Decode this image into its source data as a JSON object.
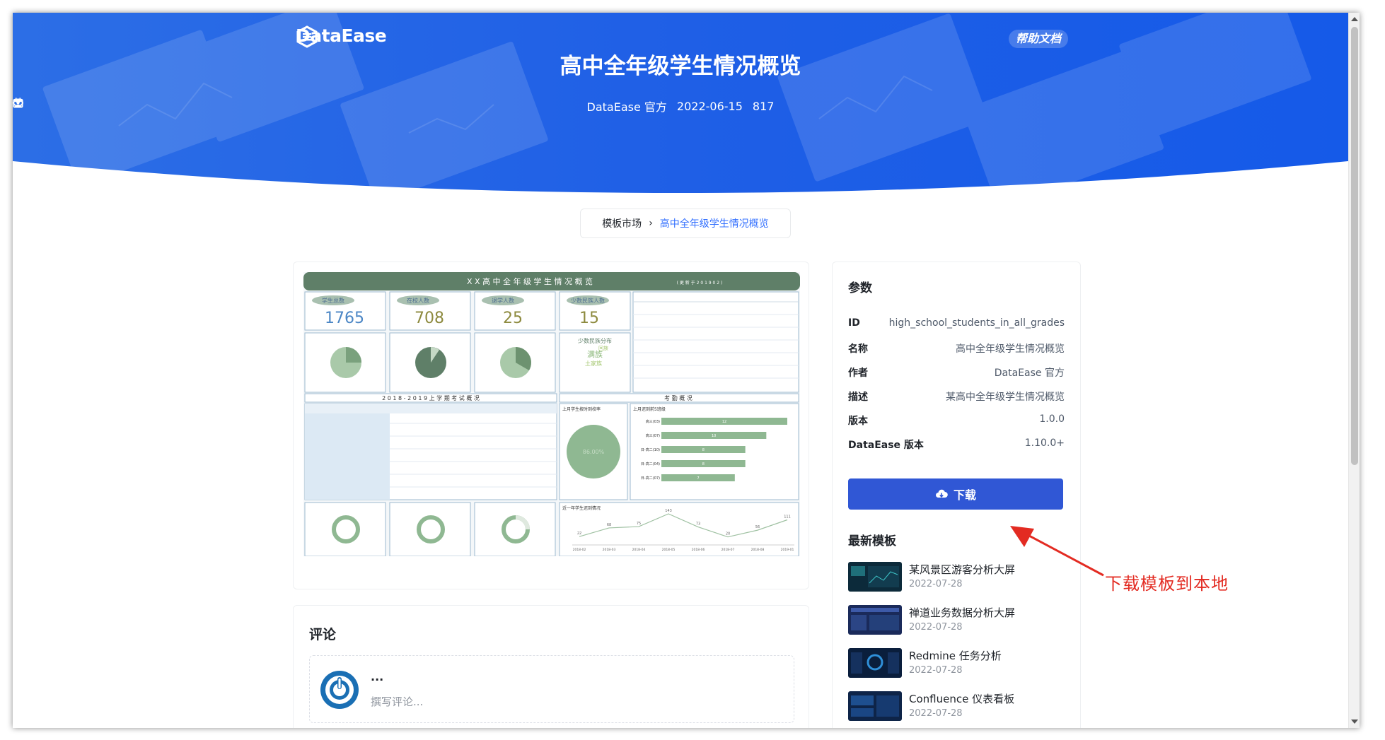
{
  "header": {
    "logo_text": "DataEase",
    "help_link": "帮助文档",
    "title": "高中全年级学生情况概览",
    "author": "DataEase 官方",
    "date": "2022-06-15",
    "views": "817"
  },
  "breadcrumb": {
    "home": "模板市场",
    "separator": "›",
    "current": "高中全年级学生情况概览"
  },
  "preview": {
    "dashboard_title": "X X 高 中 全 年 级 学 生 情 况 概 览",
    "update_note": "( 更 新 于 2 0 1 9 0 2 )",
    "kpis": [
      {
        "label": "学生总数",
        "value": "1765"
      },
      {
        "label": "在校人数",
        "value": "708"
      },
      {
        "label": "退学人数",
        "value": "25"
      },
      {
        "label": "少数民族人数",
        "value": "15"
      }
    ],
    "ethnic_title": "少数民族分布",
    "exam_title": "2 0 1 8 - 2 0 1 9 上 学 期 考 试 概 况",
    "attendance_title": "考 勤 概 况",
    "trend_title": "近一年学生迟到情况",
    "late_rank_title": "上月迟到前5班级",
    "ontime_title": "上月学生按时到校率",
    "ontime_value": "86.00%",
    "trend_values": [
      "22",
      "68",
      "75",
      "143",
      "73",
      "20",
      "56",
      "111"
    ],
    "trend_months": [
      "2018-02",
      "2018-03",
      "2018-04",
      "2018-05",
      "2018-06",
      "2018-07",
      "2018-08",
      "2019-01"
    ],
    "bar_labels": [
      "高三(03)",
      "高三(07)",
      "日-高二(10)",
      "日-高二(04)",
      "日-高二(07)"
    ],
    "bar_values": [
      "12",
      "10",
      "8",
      "8",
      "7"
    ]
  },
  "comments": {
    "title": "评论",
    "user": "...",
    "placeholder": "撰写评论..."
  },
  "params": {
    "title": "参数",
    "rows": [
      {
        "key": "ID",
        "value": "high_school_students_in_all_grades"
      },
      {
        "key": "名称",
        "value": "高中全年级学生情况概览"
      },
      {
        "key": "作者",
        "value": "DataEase 官方"
      },
      {
        "key": "描述",
        "value": "某高中全年级学生情况概览"
      },
      {
        "key": "版本",
        "value": "1.0.0"
      },
      {
        "key": "DataEase 版本",
        "value": "1.10.0+"
      }
    ],
    "download_label": "下载"
  },
  "latest": {
    "title": "最新模板",
    "items": [
      {
        "name": "某风景区游客分析大屏",
        "date": "2022-07-28"
      },
      {
        "name": "禅道业务数据分析大屏",
        "date": "2022-07-28"
      },
      {
        "name": "Redmine 任务分析",
        "date": "2022-07-28"
      },
      {
        "name": "Confluence 仪表看板",
        "date": "2022-07-28"
      }
    ]
  },
  "annotation": {
    "text": "下载模板到本地"
  },
  "colors": {
    "banner_blue": "#1e63e9",
    "download_button": "#3057d5",
    "link_blue": "#3370ff",
    "annotation_red": "#e32b22",
    "dashboard_green": "#5f7f68"
  }
}
